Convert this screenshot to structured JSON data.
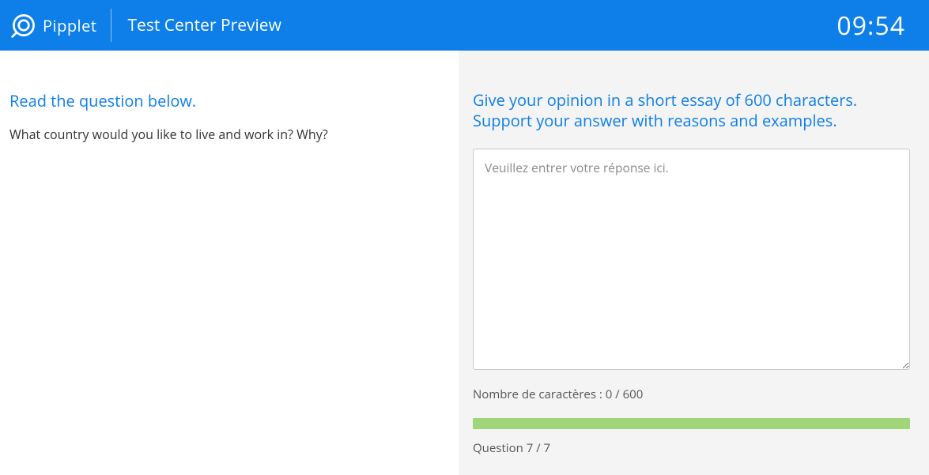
{
  "header": {
    "brand": "Pipplet",
    "title": "Test Center Preview",
    "timer": "09:54"
  },
  "left": {
    "heading": "Read the question below.",
    "question": "What country would you like to live and work in? Why?"
  },
  "right": {
    "heading": "Give your opinion in a short essay of 600 characters. Support your answer with reasons and examples.",
    "placeholder": "Veuillez entrer votre réponse ici.",
    "char_count_label": "Nombre de caractères : 0 / 600",
    "question_number": "Question 7 / 7"
  }
}
